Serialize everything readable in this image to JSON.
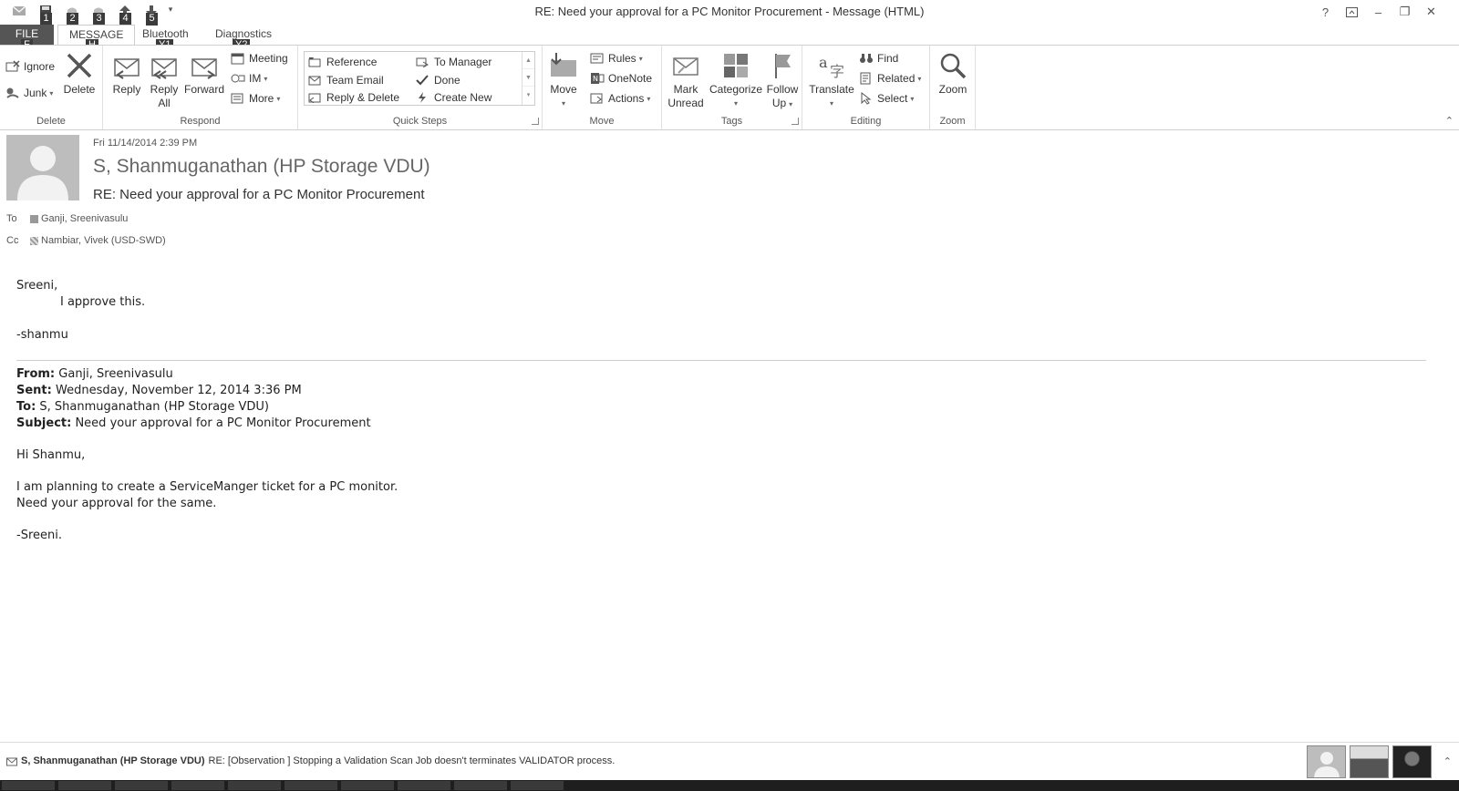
{
  "window": {
    "title": "RE: Need your approval for a PC Monitor Procurement - Message (HTML)",
    "help_label": "?",
    "min_label": "–",
    "max_label": "❐",
    "close_label": "✕"
  },
  "qat": {
    "keytips": [
      "1",
      "2",
      "3",
      "4",
      "5"
    ],
    "more_label": "▾"
  },
  "tabs": {
    "file": {
      "label": "FILE",
      "keytip": "F"
    },
    "message": {
      "label": "MESSAGE",
      "keytip": "H"
    },
    "bluetooth": {
      "label": "Bluetooth",
      "keytip": "Y1"
    },
    "diagnostics": {
      "label": "Diagnostics",
      "keytip": "Y2"
    }
  },
  "ribbon": {
    "delete": {
      "label": "Delete",
      "ignore": "Ignore",
      "junk": "Junk",
      "delete": "Delete"
    },
    "respond": {
      "label": "Respond",
      "reply": "Reply",
      "reply_all_1": "Reply",
      "reply_all_2": "All",
      "forward": "Forward",
      "meeting": "Meeting",
      "im": "IM",
      "more": "More"
    },
    "quick_steps": {
      "label": "Quick Steps",
      "reference": "Reference",
      "team_email": "Team Email",
      "reply_delete": "Reply & Delete",
      "to_manager": "To Manager",
      "done": "Done",
      "create_new": "Create New"
    },
    "move": {
      "label": "Move",
      "move": "Move",
      "rules": "Rules",
      "onenote": "OneNote",
      "actions": "Actions"
    },
    "tags": {
      "label": "Tags",
      "mark_unread_1": "Mark",
      "mark_unread_2": "Unread",
      "categorize": "Categorize",
      "follow_up_1": "Follow",
      "follow_up_2": "Up"
    },
    "editing": {
      "label": "Editing",
      "translate": "Translate",
      "find": "Find",
      "related": "Related",
      "select": "Select"
    },
    "zoom": {
      "label": "Zoom",
      "zoom": "Zoom"
    },
    "caret": "▾",
    "collapse": "⌃"
  },
  "message": {
    "date": "Fri 11/14/2014 2:39 PM",
    "sender": "S, Shanmuganathan (HP Storage VDU)",
    "subject": "RE: Need your approval for a PC Monitor Procurement",
    "to_label": "To",
    "to_value": "Ganji, Sreenivasulu",
    "cc_label": "Cc",
    "cc_value": "Nambiar, Vivek (USD-SWD)"
  },
  "body": {
    "greeting": "Sreeni,",
    "approve": "I approve this.",
    "sign": "-shanmu"
  },
  "quoted": {
    "from_label": "From:",
    "from_value": " Ganji, Sreenivasulu",
    "sent_label": "Sent:",
    "sent_value": " Wednesday, November 12, 2014 3:36 PM",
    "to_label": "To:",
    "to_value": " S, Shanmuganathan (HP Storage VDU)",
    "subject_label": "Subject:",
    "subject_value": " Need your approval for a PC Monitor Procurement",
    "greeting": "Hi Shanmu,",
    "line1": "I am planning to create a ServiceManger ticket for a PC monitor.",
    "line2": "Need your approval for the same.",
    "sign": "-Sreeni."
  },
  "people": {
    "sender": "S, Shanmuganathan (HP Storage VDU)",
    "text": "RE: [Observation ] Stopping a Validation Scan Job doesn't terminates VALIDATOR  process.",
    "collapse": "⌃"
  }
}
